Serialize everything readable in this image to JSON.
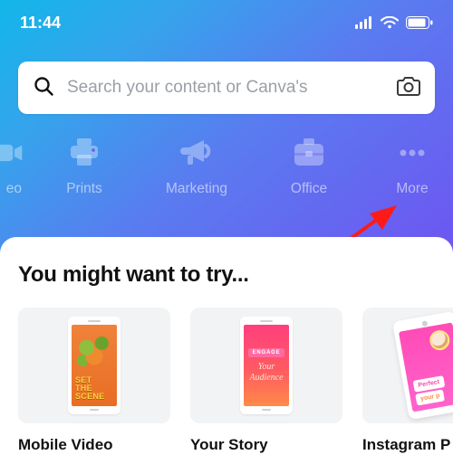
{
  "status": {
    "time": "11:44"
  },
  "search": {
    "placeholder": "Search your content or Canva's"
  },
  "categories": {
    "partial_left": "eo",
    "items": [
      {
        "label": "Prints"
      },
      {
        "label": "Marketing"
      },
      {
        "label": "Office"
      },
      {
        "label": "More"
      }
    ]
  },
  "section": {
    "title": "You might want to try..."
  },
  "cards": [
    {
      "label": "Mobile Video",
      "preview": {
        "line1": "SET",
        "line2": "THE",
        "line3": "SCENE"
      }
    },
    {
      "label": "Your Story",
      "preview": {
        "tag": "ENGAGE",
        "line1": "Your",
        "line2": "Audience"
      }
    },
    {
      "label": "Instagram P",
      "preview": {
        "line1": "Perfect",
        "line2": "your p"
      }
    }
  ]
}
